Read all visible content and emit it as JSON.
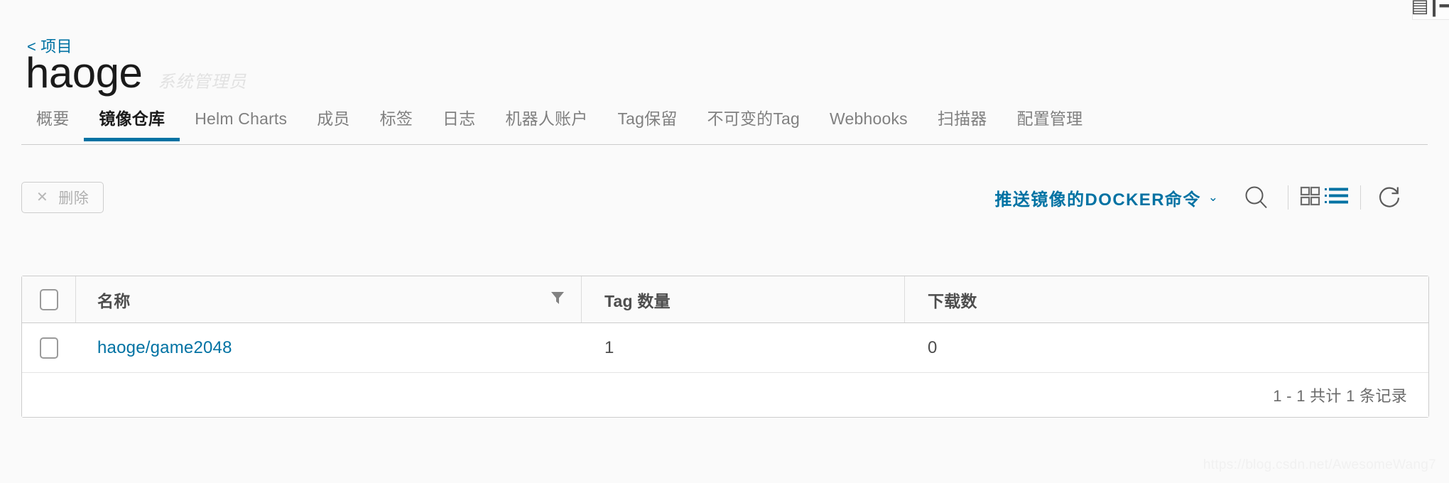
{
  "window": {
    "top_fragment_icon": "barcode-icon"
  },
  "breadcrumb": {
    "chevron": "<",
    "label": "项目"
  },
  "header": {
    "title": "haoge",
    "role_label": "系统管理员"
  },
  "tabs": [
    {
      "label": "概要",
      "active": false
    },
    {
      "label": "镜像仓库",
      "active": true
    },
    {
      "label": "Helm Charts",
      "active": false
    },
    {
      "label": "成员",
      "active": false
    },
    {
      "label": "标签",
      "active": false
    },
    {
      "label": "日志",
      "active": false
    },
    {
      "label": "机器人账户",
      "active": false
    },
    {
      "label": "Tag保留",
      "active": false
    },
    {
      "label": "不可变的Tag",
      "active": false
    },
    {
      "label": "Webhooks",
      "active": false
    },
    {
      "label": "扫描器",
      "active": false
    },
    {
      "label": "配置管理",
      "active": false
    }
  ],
  "toolbar": {
    "delete_label": "删除",
    "delete_disabled": true,
    "docker_command_label": "推送镜像的DOCKER命令",
    "docker_chevron": "⌄",
    "search_icon": "search-icon",
    "grid_view_icon": "grid-view-icon",
    "list_view_icon": "list-view-icon",
    "refresh_icon": "refresh-icon",
    "active_view": "list"
  },
  "table": {
    "columns": [
      {
        "label": "名称",
        "filterable": true
      },
      {
        "label": "Tag 数量",
        "filterable": false
      },
      {
        "label": "下载数",
        "filterable": false
      }
    ],
    "rows": [
      {
        "selected": false,
        "name": "haoge/game2048",
        "tag_count": "1",
        "downloads": "0"
      }
    ],
    "footer_text": "1 - 1 共计 1 条记录"
  },
  "watermark": "https://blog.csdn.net/AwesomeWang7",
  "colors": {
    "accent": "#0072a3",
    "text_primary": "#1a1a1a",
    "text_muted": "#808080",
    "page_bg": "#fafafa"
  }
}
